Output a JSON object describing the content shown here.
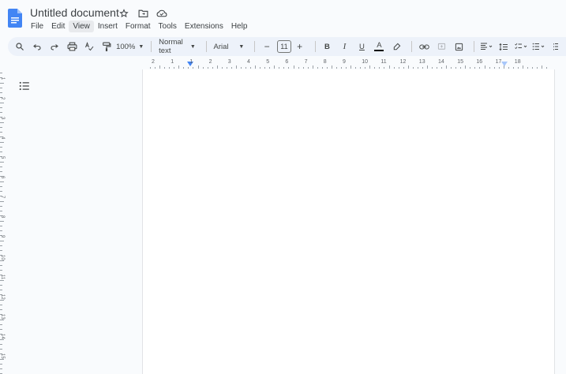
{
  "app": {
    "accent": "#4285f4",
    "doc_icon": "docs-logo-icon"
  },
  "header": {
    "title": "Untitled document"
  },
  "menu": {
    "items": [
      "File",
      "Edit",
      "View",
      "Insert",
      "Format",
      "Tools",
      "Extensions",
      "Help"
    ],
    "active": "View"
  },
  "toolbar": {
    "zoom": "100%",
    "style": "Normal text",
    "font": "Arial",
    "font_size": "11",
    "minus": "−",
    "plus": "+",
    "bold": "B",
    "italic": "I",
    "underline": "U",
    "text_color": "A"
  },
  "ruler": {
    "h_labels": [
      "2",
      "1",
      "1",
      "2",
      "3",
      "4",
      "5",
      "6",
      "7",
      "8",
      "9",
      "10",
      "11",
      "12",
      "13",
      "14",
      "15",
      "16",
      "17",
      "18"
    ],
    "v_labels": [
      "1",
      "2",
      "3",
      "4",
      "5",
      "6",
      "7",
      "8",
      "9",
      "10",
      "11",
      "12",
      "13",
      "14",
      "15"
    ]
  }
}
